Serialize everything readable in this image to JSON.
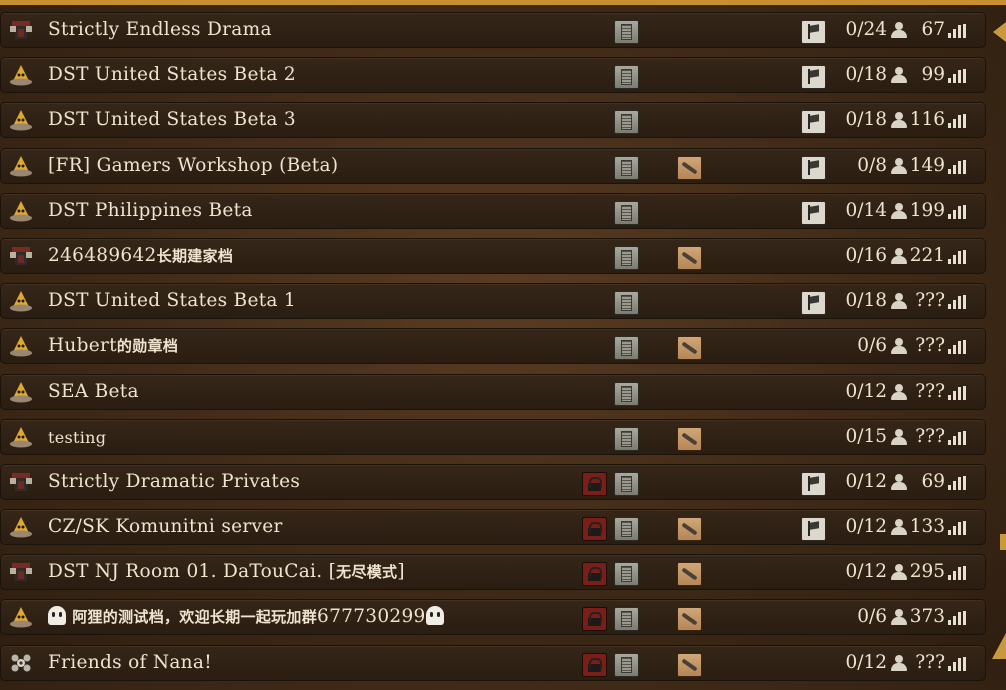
{
  "servers": [
    {
      "mode": "wilderness-icon",
      "name": "Strictly Endless Drama",
      "name_small": false,
      "lock": false,
      "dedicated": true,
      "mods": false,
      "pvp": true,
      "players": "0/24",
      "ping": "67"
    },
    {
      "mode": "survival-icon",
      "name": "DST United States Beta 2",
      "name_small": false,
      "lock": false,
      "dedicated": true,
      "mods": false,
      "pvp": true,
      "players": "0/18",
      "ping": "99"
    },
    {
      "mode": "survival-icon",
      "name": "DST United States Beta 3",
      "name_small": false,
      "lock": false,
      "dedicated": true,
      "mods": false,
      "pvp": true,
      "players": "0/18",
      "ping": "116"
    },
    {
      "mode": "survival-icon",
      "name": "[FR] Gamers Workshop (Beta)",
      "name_small": false,
      "lock": false,
      "dedicated": true,
      "mods": true,
      "pvp": true,
      "players": "0/8",
      "ping": "149"
    },
    {
      "mode": "survival-icon",
      "name": "DST Philippines Beta",
      "name_small": false,
      "lock": false,
      "dedicated": true,
      "mods": false,
      "pvp": true,
      "players": "0/14",
      "ping": "199"
    },
    {
      "mode": "wilderness-icon",
      "name": "246489642长期建家档",
      "name_small": false,
      "lock": false,
      "dedicated": true,
      "mods": true,
      "pvp": false,
      "players": "0/16",
      "ping": "221"
    },
    {
      "mode": "survival-icon",
      "name": "DST United States Beta 1",
      "name_small": false,
      "lock": false,
      "dedicated": true,
      "mods": false,
      "pvp": true,
      "players": "0/18",
      "ping": "???"
    },
    {
      "mode": "survival-icon",
      "name": "Hubert的勋章档",
      "name_small": false,
      "lock": false,
      "dedicated": true,
      "mods": true,
      "pvp": false,
      "players": "0/6",
      "ping": "???"
    },
    {
      "mode": "survival-icon",
      "name": "SEA Beta",
      "name_small": false,
      "lock": false,
      "dedicated": true,
      "mods": false,
      "pvp": false,
      "players": "0/12",
      "ping": "???"
    },
    {
      "mode": "survival-icon",
      "name": "testing",
      "name_small": true,
      "lock": false,
      "dedicated": true,
      "mods": true,
      "pvp": false,
      "players": "0/15",
      "ping": "???"
    },
    {
      "mode": "wilderness-icon",
      "name": "Strictly Dramatic Privates",
      "name_small": false,
      "lock": true,
      "dedicated": true,
      "mods": false,
      "pvp": true,
      "players": "0/12",
      "ping": "69"
    },
    {
      "mode": "survival-icon",
      "name": "CZ/SK Komunitni server",
      "name_small": false,
      "lock": true,
      "dedicated": true,
      "mods": true,
      "pvp": true,
      "players": "0/12",
      "ping": "133"
    },
    {
      "mode": "wilderness-icon",
      "name": "DST NJ Room 01. DaTouCai. [无尽模式]",
      "name_small": false,
      "lock": true,
      "dedicated": true,
      "mods": true,
      "pvp": false,
      "players": "0/12",
      "ping": "295"
    },
    {
      "mode": "survival-icon",
      "name": "阿狸的测试档，欢迎长期一起玩加群677730299",
      "name_small": false,
      "ghosts": true,
      "lock": true,
      "dedicated": true,
      "mods": true,
      "pvp": false,
      "players": "0/6",
      "ping": "373"
    },
    {
      "mode": "endless-icon",
      "name": "Friends of Nana!",
      "name_small": false,
      "lock": true,
      "dedicated": true,
      "mods": true,
      "pvp": false,
      "players": "0/12",
      "ping": "???"
    }
  ]
}
